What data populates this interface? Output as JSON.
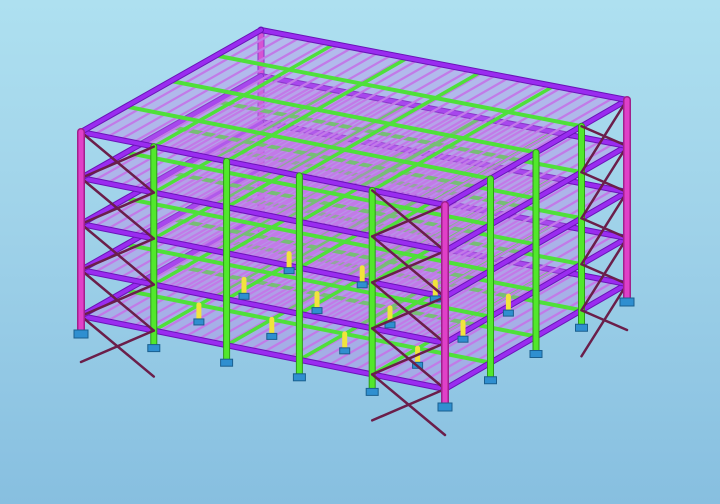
{
  "scene": {
    "type": "3d-structural-steel-frame-model",
    "storeys": 5,
    "colors": {
      "background_top": "#aee0f0",
      "background_bottom": "#87bfe0",
      "perimeter_beam": "#9a2cf0",
      "perimeter_beam_dark": "#6a14b8",
      "column_magenta": "#e040c8",
      "column_green": "#52e82c",
      "secondary_beam": "#4fe03a",
      "deck_joist": "#c27ae8",
      "stub_column": "#f1e43c",
      "brace": "#6b1e4a",
      "base_plate": "#2f8fd0"
    }
  }
}
